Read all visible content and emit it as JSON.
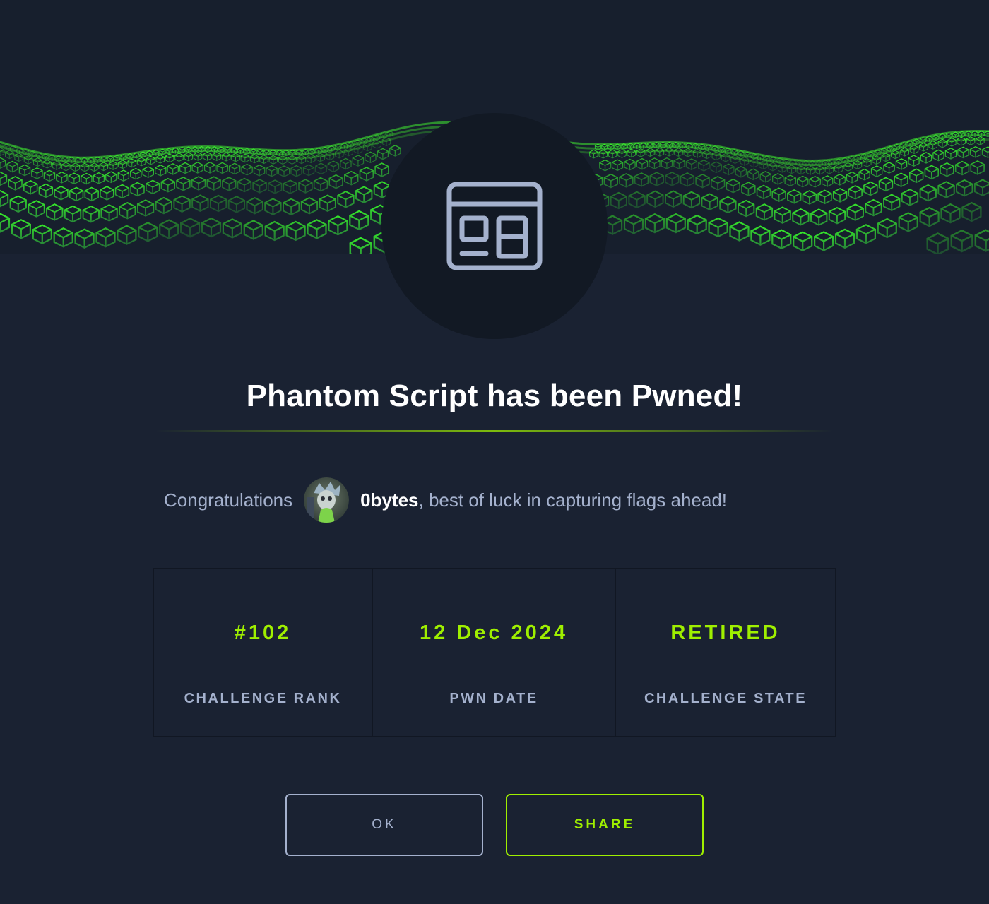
{
  "header": {
    "challenge_icon": "browser-window-icon"
  },
  "title": "Phantom Script has been Pwned!",
  "congrats": {
    "prefix": "Congratulations",
    "avatar_icon": "user-avatar",
    "username": "0bytes",
    "suffix": ", best of luck in capturing flags ahead!"
  },
  "stats": [
    {
      "value": "#102",
      "label": "CHALLENGE RANK"
    },
    {
      "value": "12 Dec 2024",
      "label": "PWN DATE"
    },
    {
      "value": "RETIRED",
      "label": "CHALLENGE STATE"
    }
  ],
  "buttons": {
    "ok_label": "OK",
    "share_label": "SHARE"
  },
  "colors": {
    "background": "#1a2232",
    "accent": "#9fef00",
    "muted_text": "#a4b1cd",
    "icon_circle": "#121924"
  }
}
